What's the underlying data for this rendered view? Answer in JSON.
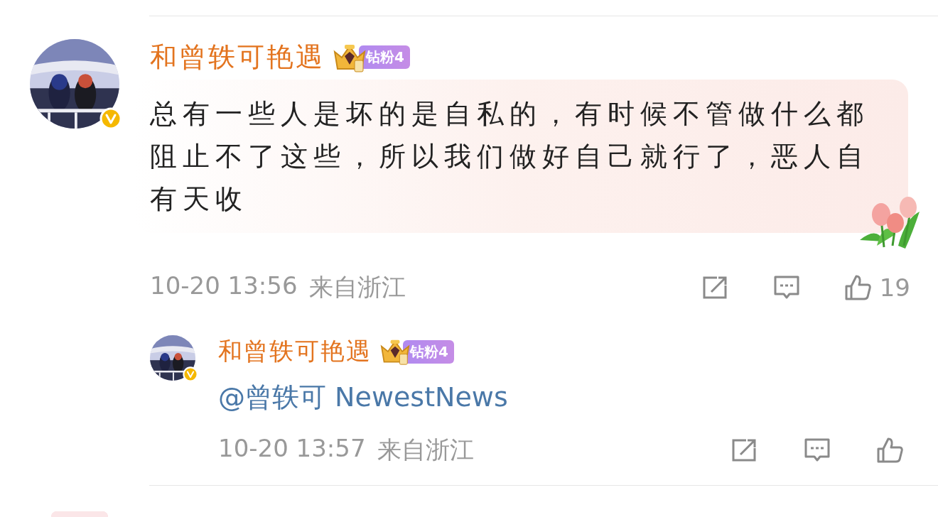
{
  "comments": [
    {
      "user": {
        "name": "和曾轶可艳遇",
        "verified": true,
        "badge": {
          "label": "钻粉4"
        }
      },
      "text": "总有一些人是坏的是自私的，有时候不管做什么都阻止不了这些，所以我们做好自己就行了，恶人自有天收",
      "time": "10-20 13:56",
      "location": "来自浙江",
      "likes": "19",
      "replies": [
        {
          "user": {
            "name": "和曾轶可艳遇",
            "verified": true,
            "badge": {
              "label": "钻粉4"
            }
          },
          "text": "@曾轶可 NewestNews",
          "time": "10-20 13:57",
          "location": "来自浙江"
        }
      ]
    }
  ]
}
